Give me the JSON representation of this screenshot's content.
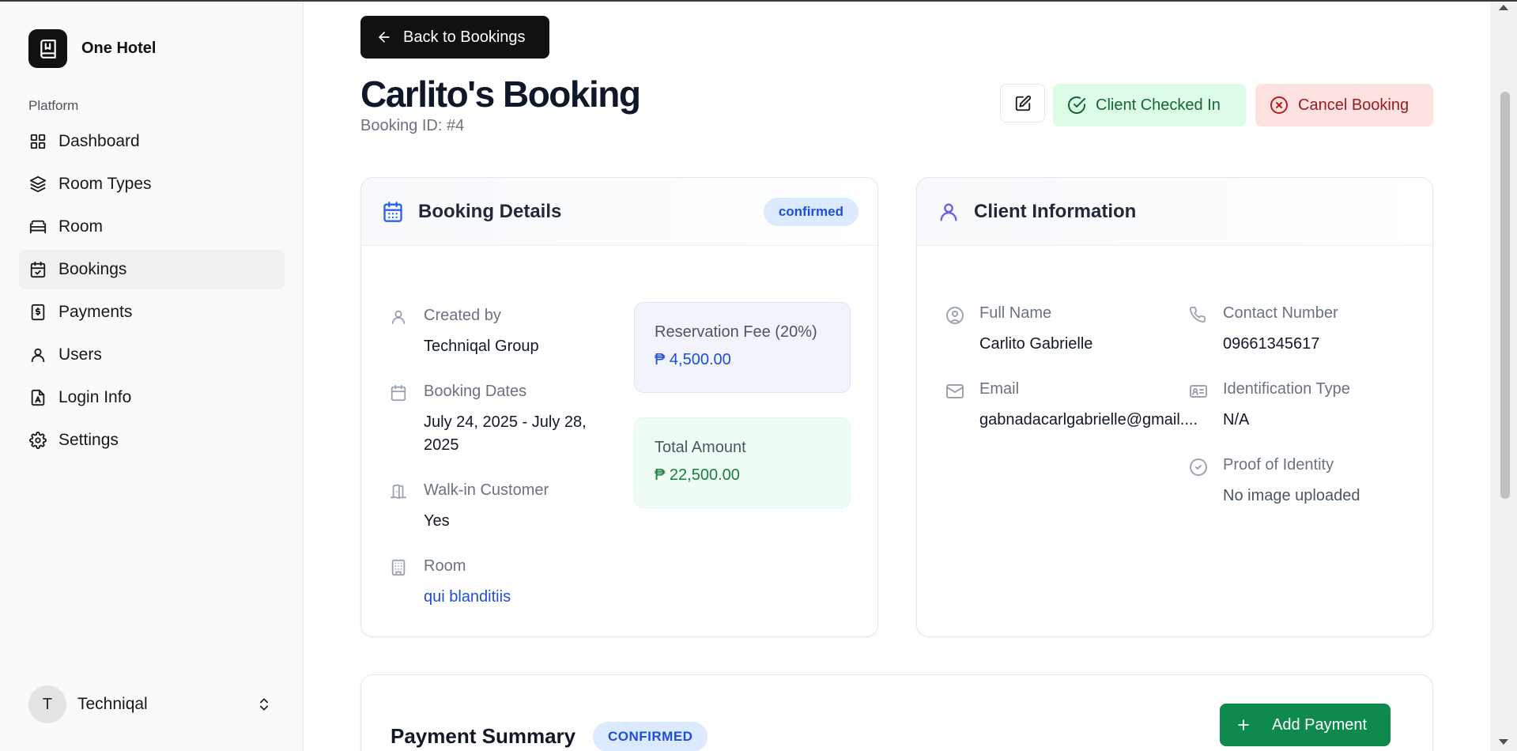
{
  "app": {
    "name": "One Hotel",
    "section": "Platform"
  },
  "sidebar": {
    "items": [
      {
        "label": "Dashboard",
        "icon": "dashboard-icon"
      },
      {
        "label": "Room Types",
        "icon": "layers-icon"
      },
      {
        "label": "Room",
        "icon": "bed-icon"
      },
      {
        "label": "Bookings",
        "icon": "calendar-check-icon",
        "active": true
      },
      {
        "label": "Payments",
        "icon": "receipt-icon"
      },
      {
        "label": "Users",
        "icon": "user-icon"
      },
      {
        "label": "Login Info",
        "icon": "file-user-icon"
      },
      {
        "label": "Settings",
        "icon": "gear-icon"
      }
    ],
    "user": {
      "initial": "T",
      "name": "Techniqal"
    }
  },
  "header": {
    "back_label": "Back to Bookings",
    "title": "Carlito's Booking",
    "booking_id": "Booking ID: #4",
    "checked_in_label": "Client Checked In",
    "cancel_label": "Cancel Booking"
  },
  "booking_details": {
    "title": "Booking Details",
    "status": "confirmed",
    "created_by_label": "Created by",
    "created_by": "Techniqal Group",
    "dates_label": "Booking Dates",
    "dates_line1": "July 24, 2025 - July 28,",
    "dates_line2": "2025",
    "walkin_label": "Walk-in Customer",
    "walkin": "Yes",
    "room_label": "Room",
    "room": "qui blanditiis",
    "reservation_fee_label": "Reservation Fee (20%)",
    "reservation_fee": "₱ 4,500.00",
    "total_label": "Total Amount",
    "total": "₱ 22,500.00"
  },
  "client_info": {
    "title": "Client Information",
    "full_name_label": "Full Name",
    "full_name": "Carlito Gabrielle",
    "contact_label": "Contact Number",
    "contact": "09661345617",
    "email_label": "Email",
    "email": "gabnadacarlgabrielle@gmail....",
    "id_type_label": "Identification Type",
    "id_type": "N/A",
    "proof_label": "Proof of Identity",
    "proof": "No image uploaded"
  },
  "payment_summary": {
    "title": "Payment Summary",
    "status": "CONFIRMED",
    "add_label": "Add Payment"
  },
  "colors": {
    "primary_dark": "#111111",
    "accent_blue": "#1d4ed8",
    "success_green": "#15803d",
    "danger_red": "#991b1b",
    "add_payment_green": "#0f8a4f"
  }
}
